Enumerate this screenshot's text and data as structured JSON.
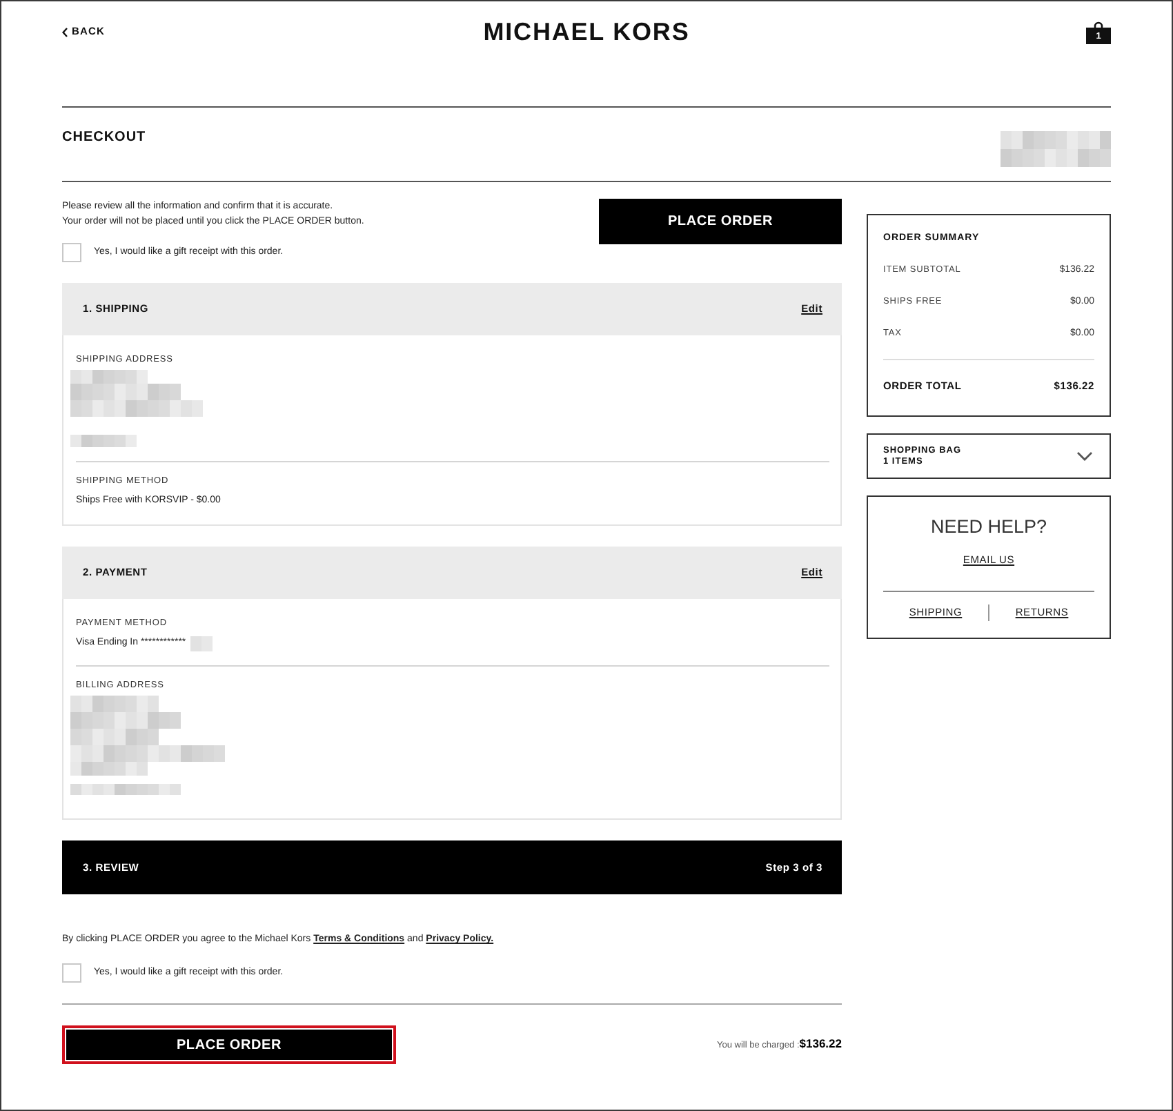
{
  "header": {
    "back_label": "BACK",
    "logo": "MICHAEL KORS",
    "bag_count": "1"
  },
  "title_bar": {
    "title": "CHECKOUT",
    "redacted": true
  },
  "intro": {
    "lines": [
      "Please review all the information and confirm that it is accurate.",
      "Your order will not be placed until you click the PLACE ORDER button."
    ],
    "gift_receipt": {
      "label": "Yes, I would like a gift receipt with this order.",
      "checked": false
    },
    "place_order_button": "PLACE ORDER"
  },
  "sections": [
    {
      "kind": "details",
      "title": "1. SHIPPING",
      "action": "Edit",
      "active": false,
      "groups": [
        {
          "kind": "redacted-short",
          "label": "SHIPPING ADDRESS"
        },
        {
          "kind": "text",
          "label": "SHIPPING METHOD",
          "value": "Ships Free with KORSVIP - $0.00"
        }
      ]
    },
    {
      "kind": "details",
      "title": "2. PAYMENT",
      "action": "Edit",
      "active": false,
      "groups": [
        {
          "kind": "text-redacted",
          "label": "PAYMENT METHOD",
          "value": "Visa Ending In ************"
        },
        {
          "kind": "redacted-tall",
          "label": "BILLING ADDRESS"
        }
      ]
    },
    {
      "kind": "review",
      "title": "3. REVIEW",
      "step": "Step 3 of 3",
      "active": true,
      "agreement": [
        {
          "kind": "text",
          "text": "By clicking PLACE ORDER you agree to the Michael Kors"
        },
        {
          "kind": "link",
          "text": "Terms & Conditions"
        },
        {
          "kind": "text",
          "text": "and"
        },
        {
          "kind": "link",
          "text": "Privacy Policy."
        }
      ],
      "gift_receipt": {
        "label": "Yes, I would like a gift receipt with this order.",
        "checked": false
      },
      "place_order_button": {
        "label": "PLACE ORDER",
        "highlighted": true
      },
      "charge": "You will be charged :**$136.22**"
    }
  ],
  "order_summary": {
    "title": "ORDER SUMMARY",
    "rows": [
      {
        "label": "ITEM SUBTOTAL",
        "value": "$136.22"
      },
      {
        "label": "SHIPS FREE",
        "value": "$0.00"
      },
      {
        "label": "TAX",
        "value": "$0.00"
      }
    ],
    "total": {
      "label": "ORDER TOTAL",
      "value": "$136.22"
    }
  },
  "shopping_bag": {
    "title": "SHOPPING BAG",
    "count": "1 ITEMS",
    "expanded": false
  },
  "help": {
    "title": "NEED HELP?",
    "email_link": "EMAIL US",
    "links": [
      "SHIPPING",
      "RETURNS"
    ]
  }
}
